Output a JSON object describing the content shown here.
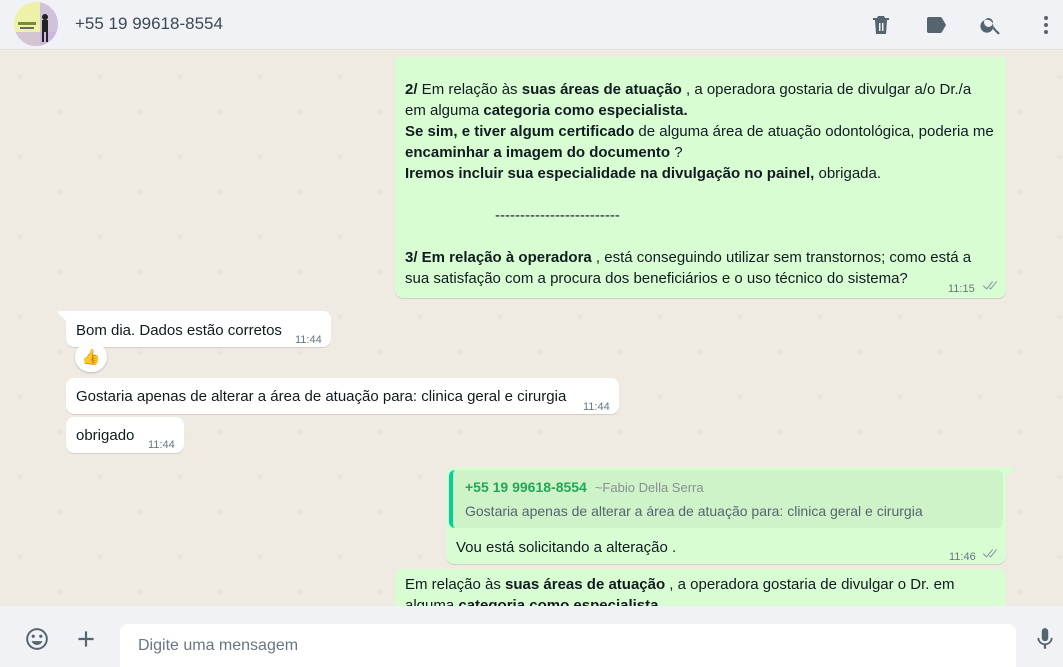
{
  "header": {
    "contact": "+55 19 99618-8554",
    "icons": [
      "delete-icon",
      "label-icon",
      "search-icon",
      "menu-icon"
    ]
  },
  "messages": {
    "m1": {
      "p2a_num": "2/",
      "p2a_pre": " Em relação às ",
      "p2a_bold": "suas áreas de atuação",
      "p2a_mid": " , a operadora gostaria de divulgar a/o Dr./a em alguma ",
      "p2a_bold2": "categoria como especialista.",
      "p2b_bold": "Se sim, e tiver algum certificado",
      "p2b_mid": " de alguma área de atuação odontológica, poderia me ",
      "p2b_bold2": "encaminhar a imagem do documento",
      "p2b_end": " ?",
      "p2c_bold": "Iremos incluir sua especialidade na divulgação no painel,",
      "p2c_end": " obrigada.",
      "dashes": "-------------------------",
      "p3_bold": "3/ Em relação à operadora",
      "p3_rest": " , está conseguindo utilizar sem transtornos; como está a sua satisfação com a procura dos beneficiários e o uso técnico do sistema?",
      "time": "11:15"
    },
    "m2": {
      "text": "Bom dia. Dados estão corretos",
      "time": "11:44",
      "reaction": "👍"
    },
    "m3": {
      "text": "Gostaria apenas de alterar a área de atuação para: clinica geral e cirurgia",
      "time": "11:44"
    },
    "m4": {
      "text": "obrigado",
      "time": "11:44"
    },
    "m5": {
      "quote_number": "+55 19 99618-8554",
      "quote_name": "~Fabio Della Serra",
      "quote_text": "Gostaria apenas de alterar a área de atuação para: clinica geral e cirurgia",
      "text": "Vou está solicitando a alteração .",
      "time": "11:46"
    },
    "m6": {
      "pre": "Em relação às ",
      "bold": "suas áreas de atuação",
      "mid": " , a operadora gostaria de divulgar o Dr. em alguma ",
      "bold2": "categoria como especialista"
    }
  },
  "composer": {
    "placeholder": "Digite uma mensagem"
  }
}
